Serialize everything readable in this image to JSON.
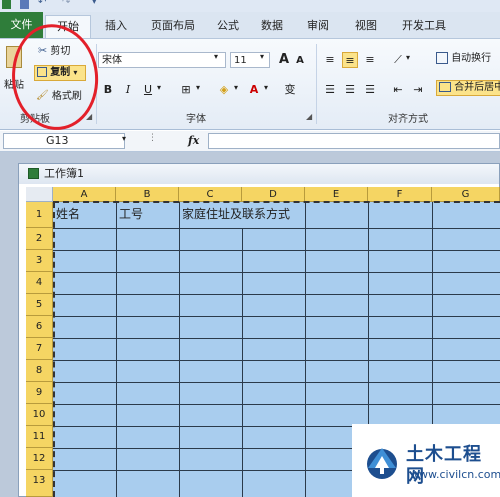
{
  "ribbon": {
    "tabs": [
      {
        "label": "文件"
      },
      {
        "label": "开始"
      },
      {
        "label": "插入"
      },
      {
        "label": "页面布局"
      },
      {
        "label": "公式"
      },
      {
        "label": "数据"
      },
      {
        "label": "审阅"
      },
      {
        "label": "视图"
      },
      {
        "label": "开发工具"
      }
    ],
    "clipboard": {
      "paste_label": "粘贴",
      "cut_label": "剪切",
      "copy_label": "复制",
      "format_painter_label": "格式刷",
      "group_label": "剪贴板"
    },
    "font": {
      "font_name": "宋体",
      "font_size": "11",
      "bold": "B",
      "italic": "I",
      "underline": "U",
      "grow": "A",
      "shrink": "A",
      "phonetic": "变",
      "group_label": "字体"
    },
    "alignment": {
      "wrap_label": "自动换行",
      "merge_label": "合并后居中",
      "group_label": "对齐方式"
    }
  },
  "formula_bar": {
    "name_box": "G13",
    "fx_label": "fx"
  },
  "workbook": {
    "title": "工作簿1",
    "columns": [
      "A",
      "B",
      "C",
      "D",
      "E",
      "F",
      "G"
    ],
    "rows": [
      "1",
      "2",
      "3",
      "4",
      "5",
      "6",
      "7",
      "8",
      "9",
      "10",
      "11",
      "12",
      "13"
    ],
    "cells": {
      "A1": "姓名",
      "B1": "工号",
      "C1": "家庭住址及联系方式"
    }
  },
  "watermark": {
    "title": "土木工程网",
    "url": "www.civilcn.com"
  },
  "colors": {
    "file_tab": "#2f7d3a",
    "selection": "#a9cdee",
    "header_highlight": "#f5d563",
    "annotation": "#e3202a"
  }
}
